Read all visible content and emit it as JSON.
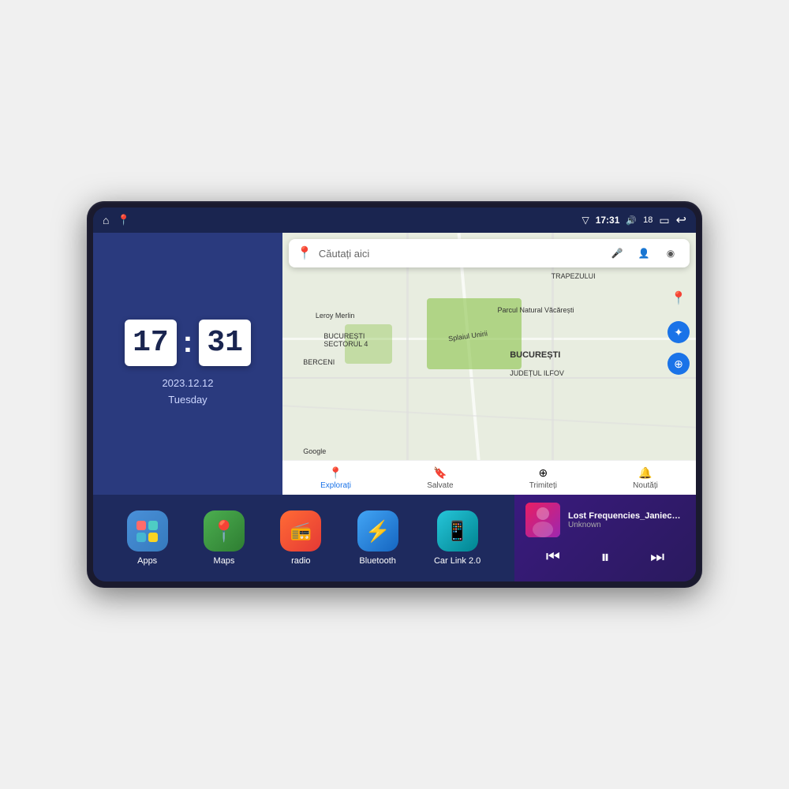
{
  "device": {
    "status_bar": {
      "left_icons": [
        "home-icon",
        "maps-pin-icon"
      ],
      "signal_icon": "▽",
      "time": "17:31",
      "volume_icon": "🔊",
      "battery_level": "18",
      "battery_icon": "🔋",
      "back_icon": "↩"
    },
    "clock": {
      "hours": "17",
      "minutes": "31",
      "date": "2023.12.12",
      "day": "Tuesday"
    },
    "map": {
      "search_placeholder": "Căutați aici",
      "locations": {
        "bucuresti": "BUCUREȘTI",
        "judetul_ilfov": "JUDEȚUL ILFOV",
        "trapezului": "TRAPEZULUI",
        "berceni": "BERCENI",
        "parcul": "Parcul Natural Văcărești",
        "leroy": "Leroy Merlin",
        "sector4": "BUCUREȘTI\nSECTORUL 4",
        "google": "Google"
      },
      "bottom_nav": [
        {
          "label": "Explorați",
          "icon": "📍",
          "active": true
        },
        {
          "label": "Salvate",
          "icon": "🔖",
          "active": false
        },
        {
          "label": "Trimiteți",
          "icon": "⊕",
          "active": false
        },
        {
          "label": "Noutăți",
          "icon": "🔔",
          "active": false
        }
      ]
    },
    "apps": [
      {
        "name": "Apps",
        "bg": "apps-bg"
      },
      {
        "name": "Maps",
        "bg": "maps-bg"
      },
      {
        "name": "radio",
        "bg": "radio-bg"
      },
      {
        "name": "Bluetooth",
        "bg": "bluetooth-bg"
      },
      {
        "name": "Car Link 2.0",
        "bg": "carlink-bg"
      }
    ],
    "music_player": {
      "title": "Lost Frequencies_Janieck Devy-...",
      "artist": "Unknown",
      "prev_label": "⏮",
      "play_label": "⏸",
      "next_label": "⏭"
    }
  }
}
